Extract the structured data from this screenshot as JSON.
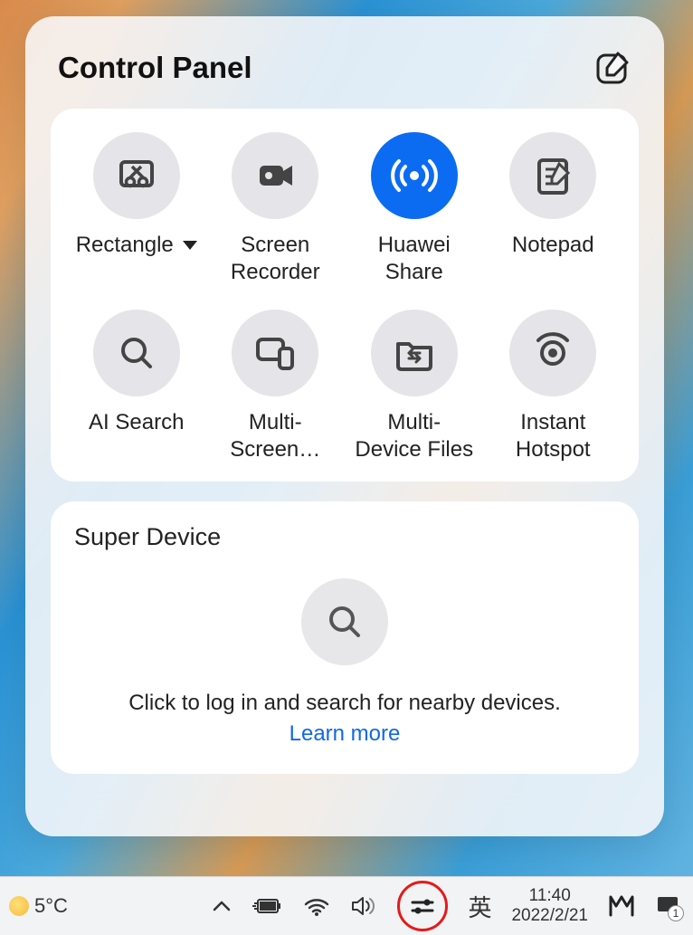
{
  "panel": {
    "title": "Control Panel",
    "tiles": [
      {
        "label": "Rectangle",
        "hasDropdown": true,
        "active": false
      },
      {
        "label": "Screen\nRecorder",
        "hasDropdown": false,
        "active": false
      },
      {
        "label": "Huawei\nShare",
        "hasDropdown": false,
        "active": true
      },
      {
        "label": "Notepad",
        "hasDropdown": false,
        "active": false
      },
      {
        "label": "AI Search",
        "hasDropdown": false,
        "active": false
      },
      {
        "label": "Multi-\nScreen…",
        "hasDropdown": false,
        "active": false
      },
      {
        "label": "Multi-\nDevice Files",
        "hasDropdown": false,
        "active": false
      },
      {
        "label": "Instant\nHotspot",
        "hasDropdown": false,
        "active": false
      }
    ]
  },
  "superDevice": {
    "title": "Super Device",
    "prompt": "Click to log in and search for nearby devices.",
    "link": "Learn more"
  },
  "taskbar": {
    "temperature": "5°C",
    "ime": "英",
    "time": "11:40",
    "date": "2022/2/21",
    "notifCount": "1"
  },
  "colors": {
    "accentBlue": "#0b6cf2",
    "linkBlue": "#1268e6",
    "ringRed": "#e51a1a"
  }
}
